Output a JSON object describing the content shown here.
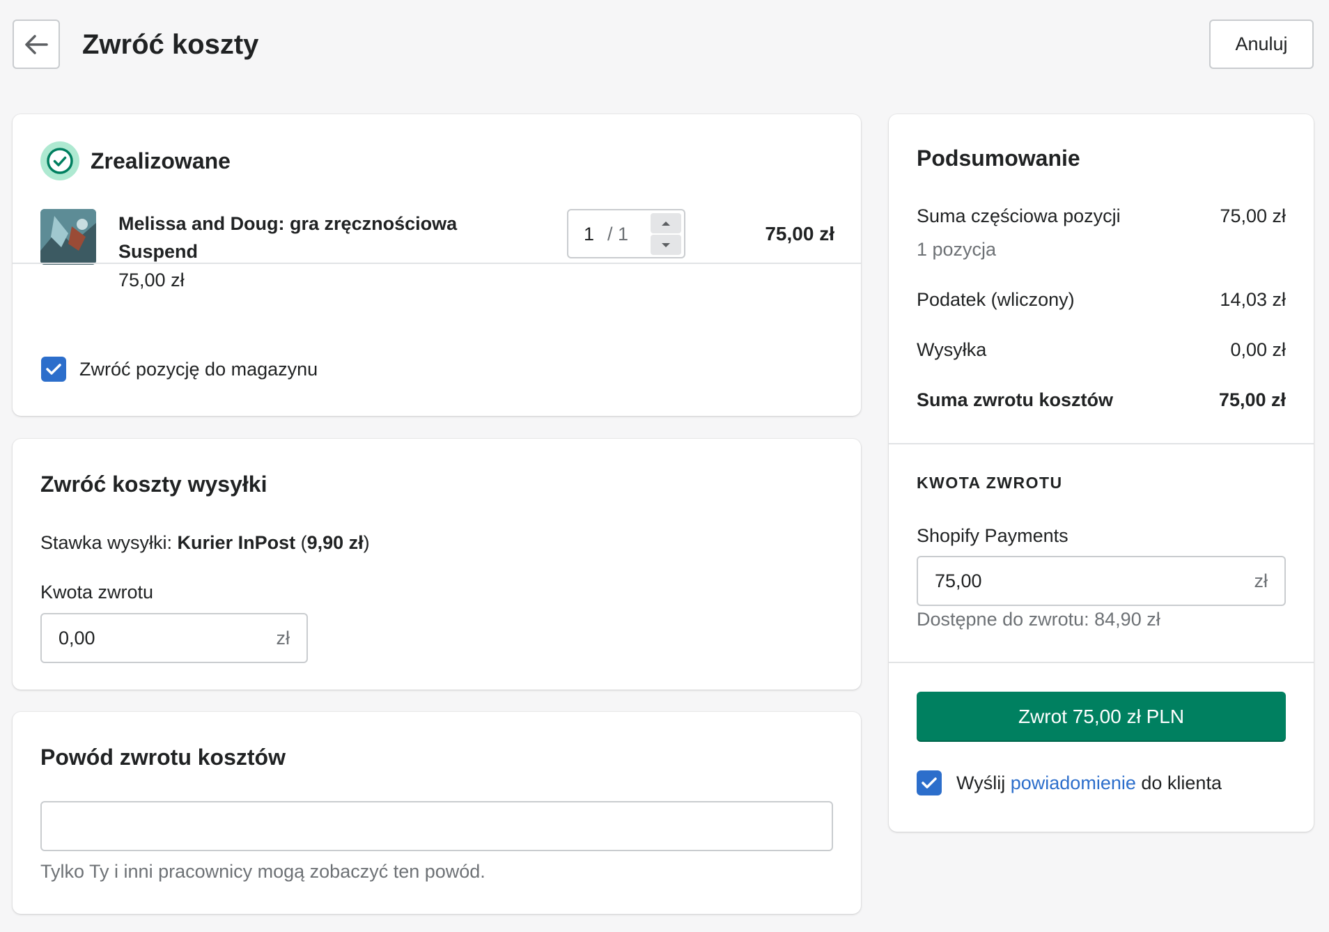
{
  "header": {
    "title": "Zwróć koszty",
    "cancel_label": "Anuluj"
  },
  "fulfilled": {
    "status": "Zrealizowane",
    "item": {
      "name": "Melissa and Doug: gra zręcznościowa Suspend",
      "unit_price": "75,00 zł",
      "quantity": "1",
      "quantity_max": "/ 1",
      "total": "75,00 zł"
    },
    "restock_label": "Zwróć pozycję do magazynu",
    "restock_checked": true
  },
  "shipping": {
    "title": "Zwróć koszty wysyłki",
    "rate_prefix": "Stawka wysyłki: ",
    "rate_name": "Kurier InPost",
    "rate_open": " (",
    "rate_amount": "9,90 zł",
    "rate_close": ")",
    "amount_label": "Kwota zwrotu",
    "amount_value": "0,00",
    "currency_suffix": "zł"
  },
  "reason": {
    "title": "Powód zwrotu kosztów",
    "value": "",
    "help": "Tylko Ty i inni pracownicy mogą zobaczyć ten powód."
  },
  "summary": {
    "title": "Podsumowanie",
    "subtotal_label": "Suma częściowa pozycji",
    "subtotal_value": "75,00 zł",
    "items_count": "1 pozycja",
    "tax_label": "Podatek (wliczony)",
    "tax_value": "14,03 zł",
    "shipping_label": "Wysyłka",
    "shipping_value": "0,00 zł",
    "total_label": "Suma zwrotu kosztów",
    "total_value": "75,00 zł",
    "refund_section_title": "KWOTA ZWROTU",
    "payment_method": "Shopify Payments",
    "payment_amount": "75,00",
    "currency_suffix": "zł",
    "available": "Dostępne do zwrotu: 84,90 zł",
    "refund_button": "Zwrot 75,00 zł PLN",
    "notify_prefix": "Wyślij ",
    "notify_link": "powiadomienie",
    "notify_suffix": " do klienta",
    "notify_checked": true
  },
  "colors": {
    "primary": "#008060",
    "checkbox": "#2c6ecb",
    "link": "#2c6ecb",
    "success_bg": "#aee9d1",
    "success_icon": "#007f5f"
  }
}
